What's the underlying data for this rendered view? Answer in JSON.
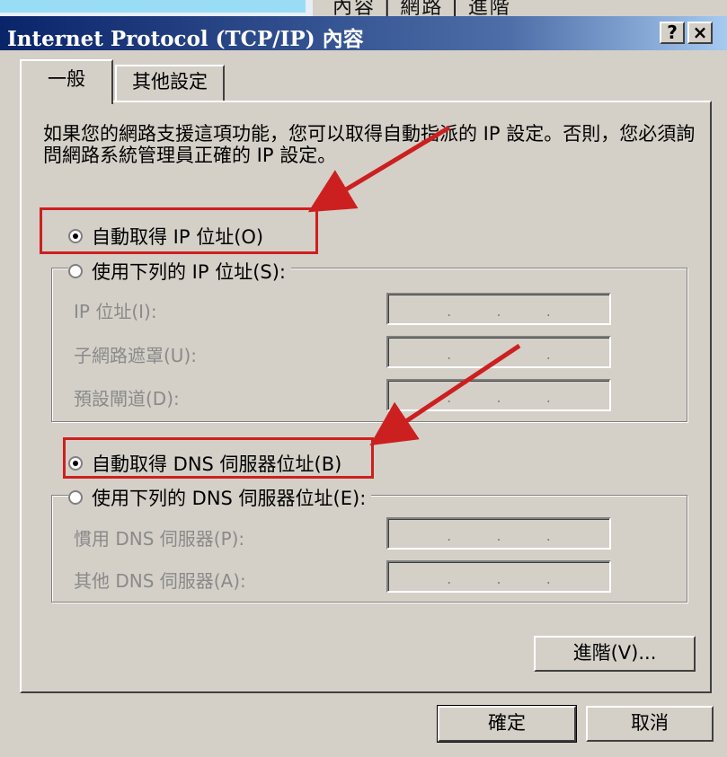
{
  "window": {
    "title": "Internet Protocol (TCP/IP) 內容",
    "help_button": "?",
    "close_button": "×",
    "behind_text": "內容 | 網路 | 進階"
  },
  "tabs": [
    {
      "label": "一般",
      "active": true
    },
    {
      "label": "其他設定",
      "active": false
    }
  ],
  "description": "如果您的網路支援這項功能，您可以取得自動指派的 IP 設定。否則，您必須詢問網路系統管理員正確的 IP 設定。",
  "ip_section": {
    "auto_label": "自動取得 IP 位址(O)",
    "auto_checked": true,
    "manual_label": "使用下列的 IP 位址(S):",
    "manual_checked": false,
    "fields": [
      {
        "label": "IP 位址(I):",
        "dots": [
          ".",
          ".",
          "."
        ]
      },
      {
        "label": "子網路遮罩(U):",
        "dots": [
          ".",
          ".",
          "."
        ]
      },
      {
        "label": "預設閘道(D):",
        "dots": [
          ".",
          ".",
          "."
        ]
      }
    ]
  },
  "dns_section": {
    "auto_label": "自動取得 DNS 伺服器位址(B)",
    "auto_checked": true,
    "manual_label": "使用下列的 DNS 伺服器位址(E):",
    "manual_checked": false,
    "fields": [
      {
        "label": "慣用 DNS 伺服器(P):",
        "dots": [
          ".",
          ".",
          "."
        ]
      },
      {
        "label": "其他 DNS 伺服器(A):",
        "dots": [
          ".",
          ".",
          "."
        ]
      }
    ]
  },
  "buttons": {
    "advanced": "進階(V)...",
    "ok": "確定",
    "cancel": "取消"
  },
  "annotation_color": "#cc2020"
}
